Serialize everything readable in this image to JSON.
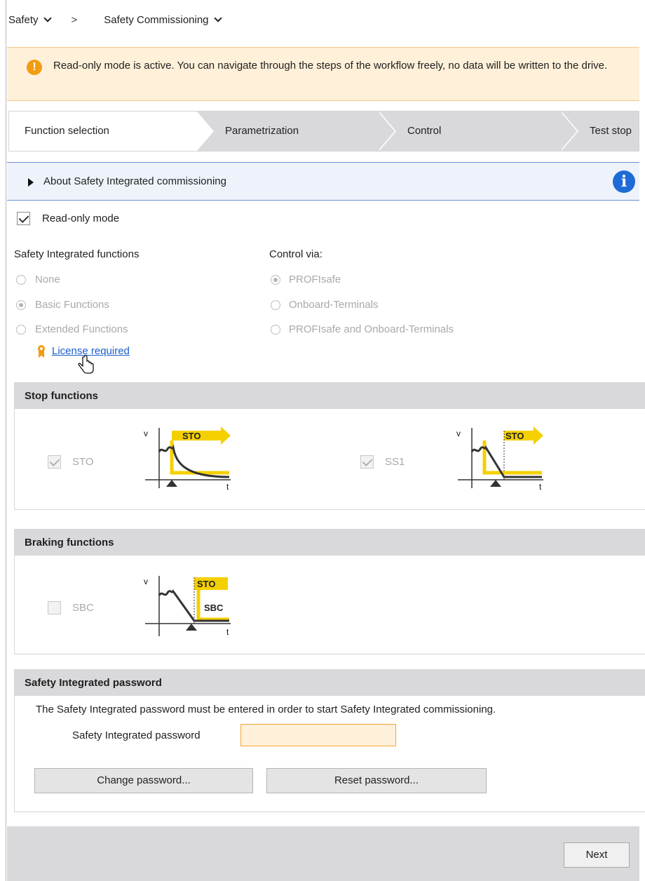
{
  "breadcrumb": {
    "level1": "Safety",
    "separator": ">",
    "level2": "Safety Commissioning"
  },
  "warning": {
    "icon": "exclamation-icon",
    "text": "Read-only mode is active. You can navigate through the steps of the workflow freely, no data will be written to the drive."
  },
  "steps": [
    {
      "label": "Function selection",
      "active": true
    },
    {
      "label": "Parametrization",
      "active": false
    },
    {
      "label": "Control",
      "active": false
    },
    {
      "label": "Test stop",
      "active": false
    }
  ],
  "about": {
    "label": "About Safety Integrated commissioning",
    "icon": "info-icon"
  },
  "read_only": {
    "label": "Read-only mode",
    "checked": true
  },
  "functions": {
    "heading": "Safety Integrated functions",
    "options": [
      "None",
      "Basic Functions",
      "Extended Functions"
    ],
    "selected": "Basic Functions",
    "license_link": "License required"
  },
  "control_via": {
    "heading": "Control via:",
    "options": [
      "PROFIsafe",
      "Onboard-Terminals",
      "PROFIsafe and Onboard-Terminals"
    ],
    "selected": "PROFIsafe"
  },
  "stop_functions": {
    "heading": "Stop functions",
    "items": [
      {
        "label": "STO",
        "checked": true,
        "diagram_tag": "STO",
        "axis_v": "v",
        "axis_t": "t"
      },
      {
        "label": "SS1",
        "checked": true,
        "diagram_tag": "STO",
        "axis_v": "v",
        "axis_t": "t"
      }
    ]
  },
  "braking_functions": {
    "heading": "Braking functions",
    "items": [
      {
        "label": "SBC",
        "checked": false,
        "diagram_tag": "STO",
        "diagram_tag2": "SBC",
        "axis_v": "v",
        "axis_t": "t"
      }
    ]
  },
  "password": {
    "heading": "Safety Integrated password",
    "description": "The Safety Integrated password must be entered in order to start Safety Integrated commissioning.",
    "field_label": "Safety Integrated password",
    "value": "",
    "change_button": "Change password...",
    "reset_button": "Reset password..."
  },
  "footer": {
    "next_button": "Next"
  },
  "colors": {
    "accent_yellow": "#f5d000",
    "warning_bg": "#fff0d9",
    "info_blue": "#1e6ad6",
    "link": "#1a5ec9"
  }
}
